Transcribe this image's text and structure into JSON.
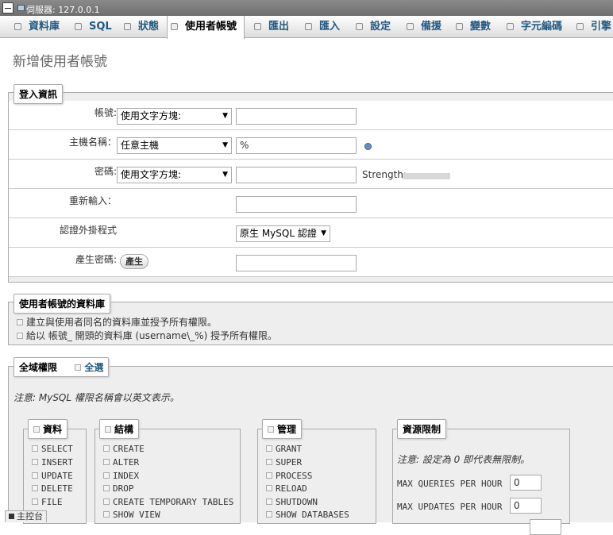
{
  "server_bar": {
    "title": "伺服器: 127.0.0.1"
  },
  "tabs": [
    {
      "label": "資料庫",
      "icon": "database-icon"
    },
    {
      "label": "SQL",
      "icon": "sql-icon"
    },
    {
      "label": "狀態",
      "icon": "status-icon"
    },
    {
      "label": "使用者帳號",
      "icon": "users-icon",
      "active": true
    },
    {
      "label": "匯出",
      "icon": "export-icon"
    },
    {
      "label": "匯入",
      "icon": "import-icon"
    },
    {
      "label": "設定",
      "icon": "settings-icon"
    },
    {
      "label": "備援",
      "icon": "replication-icon"
    },
    {
      "label": "變數",
      "icon": "variables-icon"
    },
    {
      "label": "字元編碼",
      "icon": "charset-icon"
    },
    {
      "label": "引擎",
      "icon": "engines-icon"
    }
  ],
  "page_title": "新增使用者帳號",
  "login": {
    "legend": "登入資訊",
    "username_label": "帳號:",
    "username_select": "使用文字方塊:",
    "hostname_label": "主機名稱：",
    "hostname_select": "任意主機",
    "hostname_value": "%",
    "password_label": "密碼:",
    "password_select": "使用文字方塊:",
    "strength_label": "Strength:",
    "retype_label": "重新輸入：",
    "auth_label": "認證外掛程式",
    "auth_select": "原生 MySQL 認證",
    "generate_label": "產生密碼:",
    "generate_button": "產生"
  },
  "database": {
    "legend": "使用者帳號的資料庫",
    "option1": "建立與使用者同名的資料庫並授予所有權限。",
    "option2": "給以 帳號_ 開頭的資料庫 (username\\_%) 授予所有權限。"
  },
  "global": {
    "legend": "全域權限",
    "check_all": "全選",
    "note": "注意: MySQL 權限名稱會以英文表示。"
  },
  "groups": {
    "data": {
      "legend": "資料",
      "items": [
        "SELECT",
        "INSERT",
        "UPDATE",
        "DELETE",
        "FILE"
      ]
    },
    "structure": {
      "legend": "結構",
      "items": [
        "CREATE",
        "ALTER",
        "INDEX",
        "DROP",
        "CREATE TEMPORARY TABLES",
        "SHOW VIEW"
      ]
    },
    "admin": {
      "legend": "管理",
      "items": [
        "GRANT",
        "SUPER",
        "PROCESS",
        "RELOAD",
        "SHUTDOWN",
        "SHOW DATABASES"
      ]
    },
    "limits": {
      "legend": "資源限制",
      "note": "注意: 設定為 0 即代表無限制。",
      "max_queries_label": "MAX QUERIES PER HOUR",
      "max_queries_value": "0",
      "max_updates_label": "MAX UPDATES PER HOUR",
      "max_updates_value": "0"
    }
  },
  "console": {
    "label": "主控台"
  }
}
